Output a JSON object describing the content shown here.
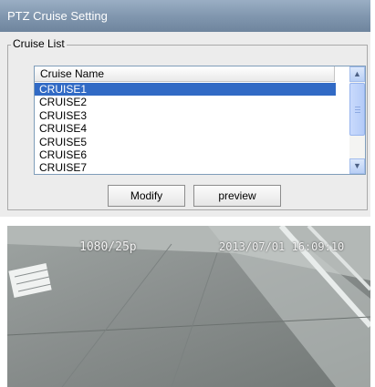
{
  "window": {
    "title": "PTZ Cruise Setting"
  },
  "cruise_list": {
    "legend": "Cruise List",
    "column_header": "Cruise Name",
    "items": [
      "CRUISE1",
      "CRUISE2",
      "CRUISE3",
      "CRUISE4",
      "CRUISE5",
      "CRUISE6",
      "CRUISE7"
    ],
    "selected": "CRUISE1"
  },
  "buttons": {
    "modify": "Modify",
    "preview": "preview"
  },
  "video": {
    "resolution": "1080/25p",
    "timestamp": "2013/07/01 16:09:10"
  },
  "colors": {
    "selection": "#316ac5",
    "titlebar": "#7f95ad"
  }
}
